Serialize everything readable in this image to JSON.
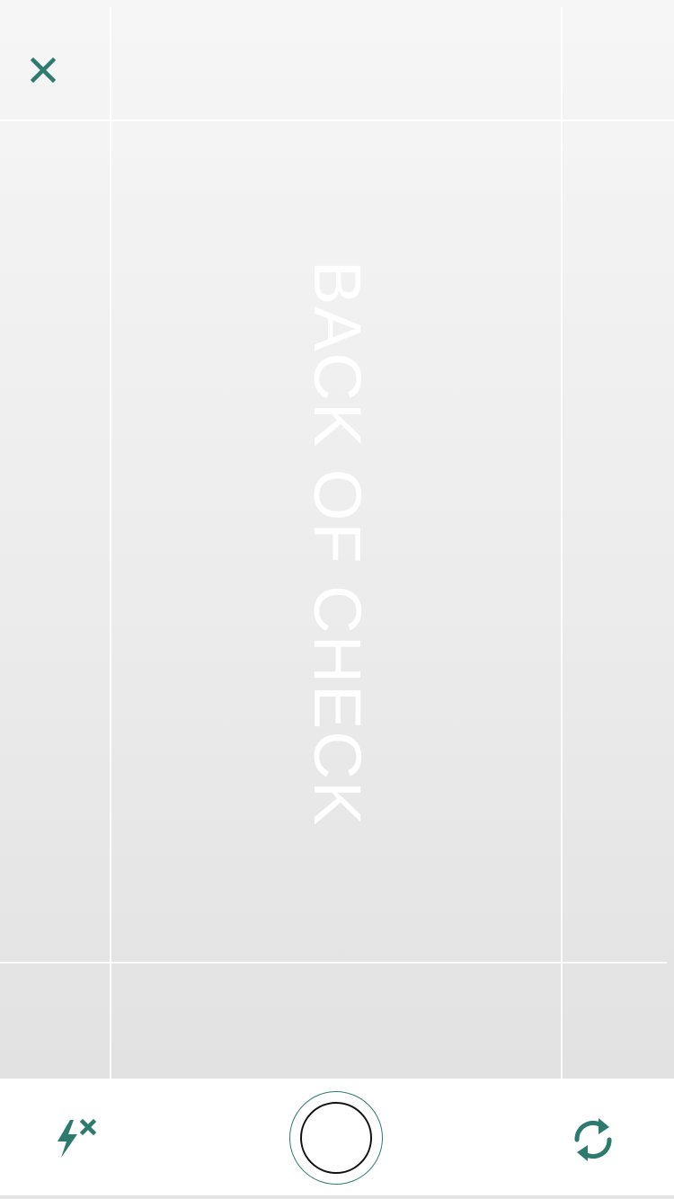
{
  "camera": {
    "guide_text": "BACK OF CHECK"
  },
  "controls": {
    "close_icon": "close-icon",
    "flash_icon": "flash-off-icon",
    "shutter": "shutter-button",
    "switch_icon": "switch-camera-icon"
  },
  "colors": {
    "accent": "#2d7a6f",
    "viewfinder_top": "#f6f6f6",
    "viewfinder_bottom": "#e2e2e2",
    "controls_bg": "#ffffff"
  }
}
